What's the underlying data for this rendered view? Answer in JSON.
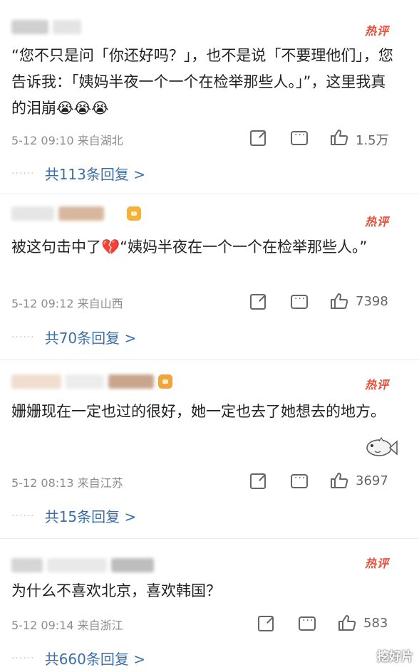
{
  "hot_tag_label": "热评",
  "comments": [
    {
      "text": "“您不只是问「你还好吗？」，也不是说「不要理他们」，您告诉我：「姨妈半夜一个一个在检举那些人。」”，这里我真的泪崩😭😭😭",
      "meta": "5-12 09:10  来自湖北",
      "likes": "1.5万",
      "replies_label": "共113条回复 >"
    },
    {
      "text": "被这句击中了💔“姨妈半夜在一个一个在检举那些人。”",
      "meta": "5-12 09:12  来自山西",
      "likes": "7398",
      "replies_label": "共70条回复 >"
    },
    {
      "text": "姗姗现在一定也过的很好，她一定也去了她想去的地方。",
      "meta": "5-12 08:13  来自江苏",
      "likes": "3697",
      "replies_label": "共15条回复 >"
    },
    {
      "text": "为什么不喜欢北京，喜欢韩国？",
      "meta": "5-12 09:14  来自浙江",
      "likes": "583",
      "replies_label": "共660条回复 >"
    }
  ],
  "dots": "······",
  "watermark": "挖好片",
  "colors": {
    "hot": "#e8503a",
    "link": "#3b6ea6",
    "meta": "#8c8c8c"
  },
  "icons": [
    "share-icon",
    "comment-icon",
    "like-icon",
    "fish-sticker-icon",
    "crown-badge-icon",
    "broken-heart-emoji"
  ]
}
